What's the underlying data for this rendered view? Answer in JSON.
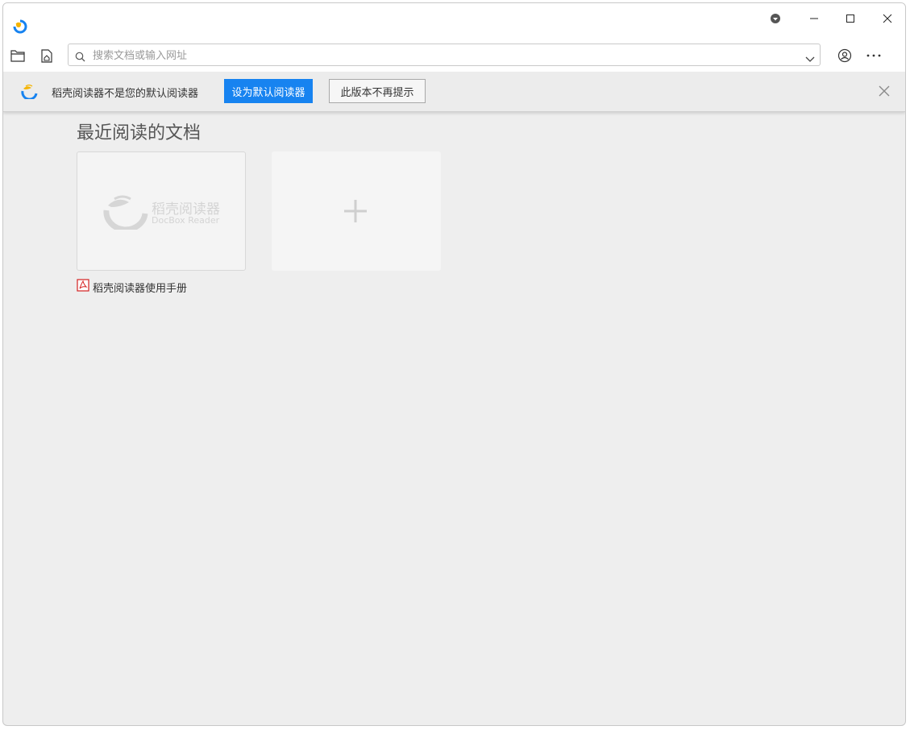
{
  "titlebar": {
    "logo_icon": "app-logo-icon",
    "controls": [
      "dropdown-circle-icon",
      "minimize-icon",
      "maximize-icon",
      "close-icon"
    ]
  },
  "toolbar": {
    "open_folder_icon": "folder-icon",
    "home_icon": "home-icon",
    "search_placeholder": "搜索文档或输入网址",
    "search_value": "",
    "account_icon": "user-icon",
    "more_icon": "more-icon"
  },
  "notice": {
    "message": "稻壳阅读器不是您的默认阅读器",
    "set_default_label": "设为默认阅读器",
    "dismiss_label": "此版本不再提示",
    "primary_color": "#1783f0"
  },
  "main": {
    "section_title": "最近阅读的文档",
    "recent_docs": [
      {
        "thumb_title": "稻壳阅读器",
        "thumb_subtitle": "DocBox Reader",
        "name": "稻壳阅读器使用手册",
        "type_icon": "pdf-icon"
      }
    ],
    "add_icon": "plus-icon"
  }
}
